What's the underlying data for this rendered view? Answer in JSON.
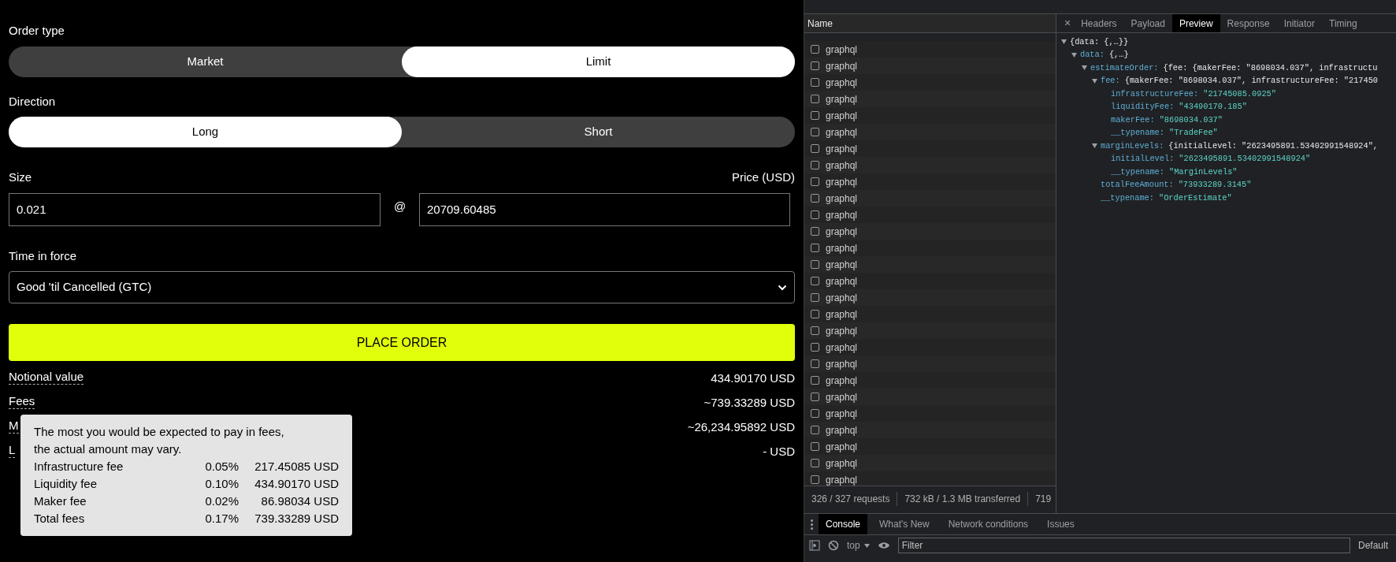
{
  "order_form": {
    "order_type": {
      "label": "Order type",
      "options": [
        {
          "label": "Market",
          "selected": false
        },
        {
          "label": "Limit",
          "selected": true
        }
      ]
    },
    "direction": {
      "label": "Direction",
      "options": [
        {
          "label": "Long",
          "selected": true
        },
        {
          "label": "Short",
          "selected": false
        }
      ]
    },
    "size": {
      "label": "Size",
      "value": "0.021"
    },
    "at_sign": "@",
    "price": {
      "label": "Price (USD)",
      "value": "20709.60485"
    },
    "time_in_force": {
      "label": "Time in force",
      "value": "Good 'til Cancelled (GTC)"
    },
    "place_order_button": "PLACE ORDER",
    "summary": [
      {
        "label": "Notional value",
        "value": "434.90170 USD"
      },
      {
        "label": "Fees",
        "value": "~739.33289 USD"
      },
      {
        "label": "M",
        "value": "~26,234.95892 USD"
      },
      {
        "label": "L",
        "value": "- USD"
      }
    ],
    "tooltip": {
      "text": "The most you would be expected to pay in fees, the actual amount may vary.",
      "rows": [
        {
          "name": "Infrastructure fee",
          "percent": "0.05%",
          "amount": "217.45085 USD"
        },
        {
          "name": "Liquidity fee",
          "percent": "0.10%",
          "amount": "434.90170 USD"
        },
        {
          "name": "Maker fee",
          "percent": "0.02%",
          "amount": "86.98034 USD"
        },
        {
          "name": "Total fees",
          "percent": "0.17%",
          "amount": "739.33289 USD"
        }
      ]
    }
  },
  "devtools": {
    "name_column": {
      "header": "Name",
      "rows": [
        "graphql",
        "graphql",
        "graphql",
        "graphql",
        "graphql",
        "graphql",
        "graphql",
        "graphql",
        "graphql",
        "graphql",
        "graphql",
        "graphql",
        "graphql",
        "graphql",
        "graphql",
        "graphql",
        "graphql",
        "graphql",
        "graphql",
        "graphql",
        "graphql",
        "graphql",
        "graphql",
        "graphql",
        "graphql",
        "graphql",
        "graphql"
      ]
    },
    "status_bar": [
      "326 / 327 requests",
      "732 kB / 1.3 MB transferred",
      "719"
    ],
    "detail_tabs": [
      {
        "label": "Headers",
        "selected": false
      },
      {
        "label": "Payload",
        "selected": false
      },
      {
        "label": "Preview",
        "selected": true
      },
      {
        "label": "Response",
        "selected": false
      },
      {
        "label": "Initiator",
        "selected": false
      },
      {
        "label": "Timing",
        "selected": false
      }
    ],
    "close_glyph": "×",
    "preview": [
      {
        "value": "{data: {,…}}",
        "expanded": true,
        "children": [
          {
            "key": "data:",
            "value": "{,…}",
            "expanded": true,
            "children": [
              {
                "key": "estimateOrder:",
                "value": "{fee: {makerFee: \"8698034.037\", infrastructu",
                "expanded": true,
                "children": [
                  {
                    "key": "fee:",
                    "value": "{makerFee: \"8698034.037\", infrastructureFee: \"217450",
                    "expanded": true,
                    "children": [
                      {
                        "key": "infrastructureFee:",
                        "value": "\"21745085.0925\""
                      },
                      {
                        "key": "liquidityFee:",
                        "value": "\"43490170.185\""
                      },
                      {
                        "key": "makerFee:",
                        "value": "\"8698034.037\""
                      },
                      {
                        "key": "__typename:",
                        "value": "\"TradeFee\""
                      }
                    ]
                  },
                  {
                    "key": "marginLevels:",
                    "value": "{initialLevel: \"2623495891.53402991548924\",",
                    "expanded": true,
                    "children": [
                      {
                        "key": "initialLevel:",
                        "value": "\"2623495891.53402991548924\""
                      },
                      {
                        "key": "__typename:",
                        "value": "\"MarginLevels\""
                      }
                    ]
                  },
                  {
                    "key": "totalFeeAmount:",
                    "value": "\"73933289.3145\""
                  },
                  {
                    "key": "__typename:",
                    "value": "\"OrderEstimate\""
                  }
                ]
              }
            ]
          }
        ]
      }
    ],
    "drawer_tabs": [
      {
        "label": "Console",
        "selected": true
      },
      {
        "label": "What's New",
        "selected": false
      },
      {
        "label": "Network conditions",
        "selected": false
      },
      {
        "label": "Issues",
        "selected": false
      }
    ],
    "console_toolbar": {
      "context": "top",
      "filter_placeholder": "Filter",
      "levels": "Default"
    }
  }
}
